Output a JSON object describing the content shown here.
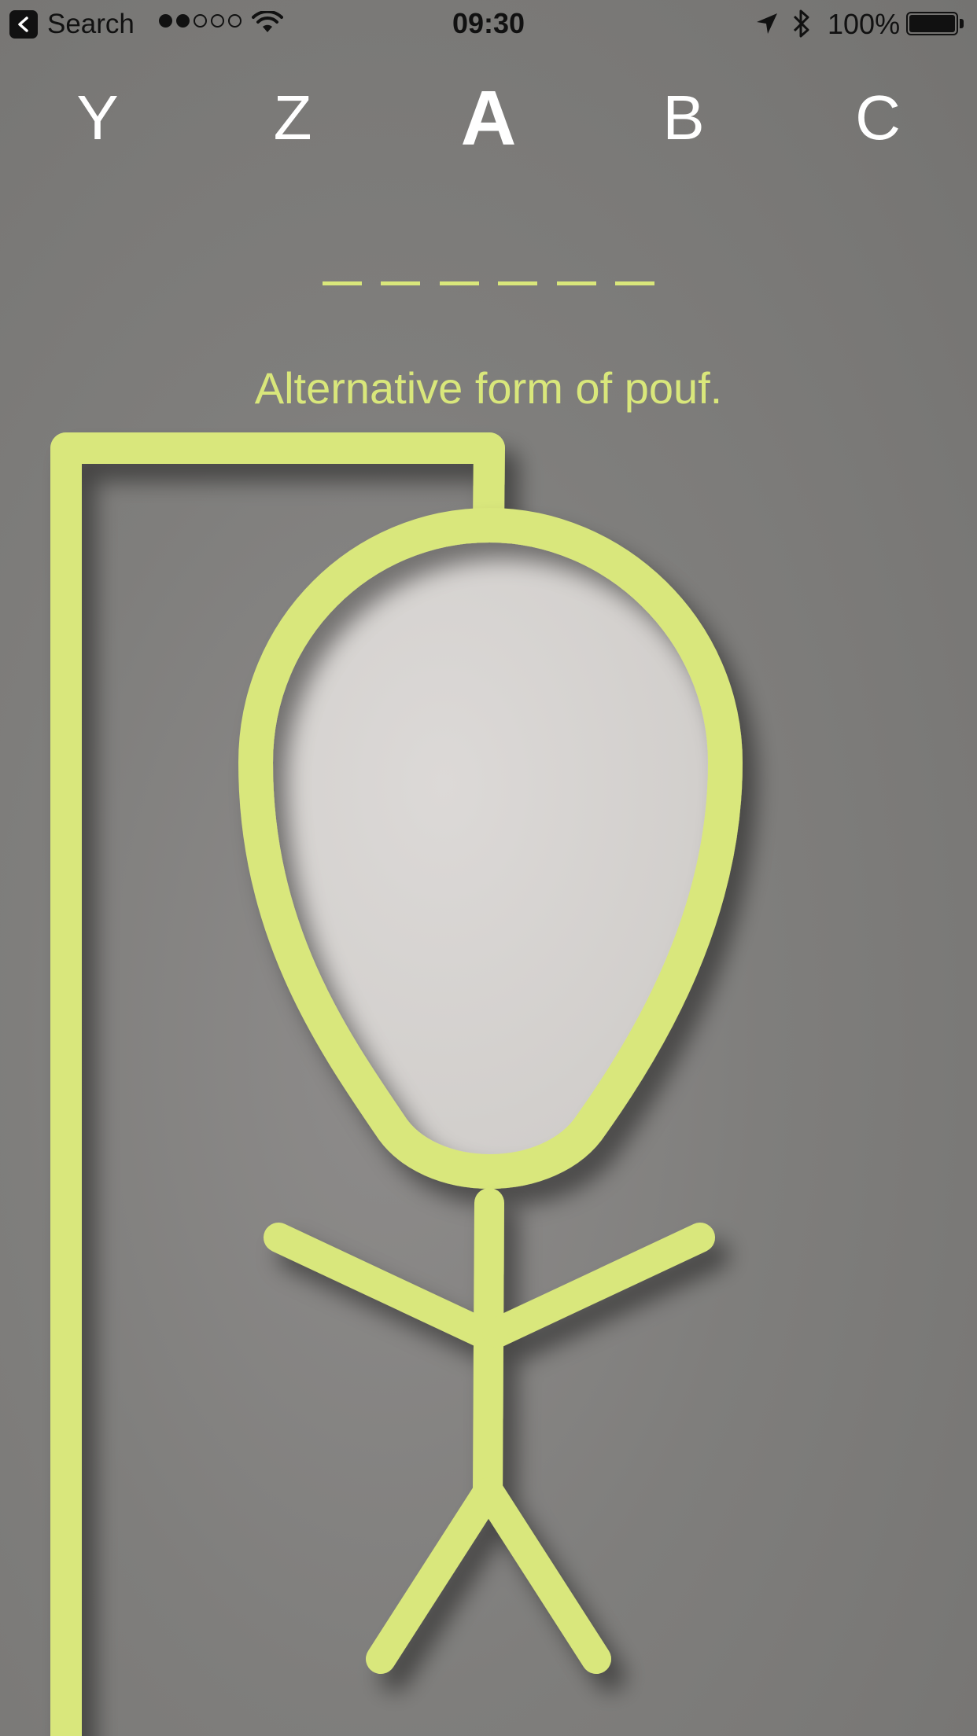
{
  "status_bar": {
    "back_label": "Search",
    "signal_bars_filled": 2,
    "signal_bars_total": 5,
    "time": "09:30",
    "battery_percent": "100%"
  },
  "letter_picker": {
    "letters": [
      "Y",
      "Z",
      "A",
      "B",
      "C"
    ],
    "selected": "A"
  },
  "puzzle": {
    "word_length": 6,
    "clue": "Alternative form of pouf."
  },
  "colors": {
    "accent": "#d9e77b",
    "head_fill": "#d8d5d2",
    "background": "#7f7e7c"
  },
  "icons": {
    "back": "back-chevron-icon",
    "wifi": "wifi-icon",
    "location": "location-arrow-icon",
    "bluetooth": "bluetooth-icon",
    "battery": "battery-icon"
  }
}
